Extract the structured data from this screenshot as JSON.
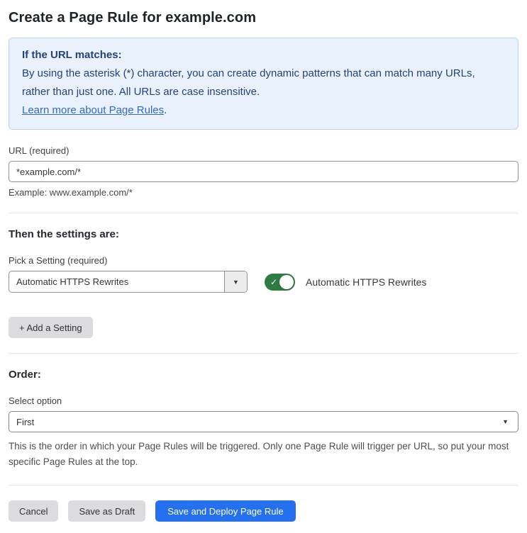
{
  "page": {
    "title": "Create a Page Rule for example.com"
  },
  "info_box": {
    "heading": "If the URL matches:",
    "body": "By using the asterisk (*) character, you can create dynamic patterns that can match many URLs, rather than just one. All URLs are case insensitive.",
    "link_label": "Learn more about Page Rules",
    "link_suffix": "."
  },
  "url_field": {
    "label": "URL (required)",
    "value": "*example.com/*",
    "hint": "Example: www.example.com/*"
  },
  "settings_section": {
    "heading": "Then the settings are:",
    "pick_label": "Pick a Setting (required)",
    "dropdown_value": "Automatic HTTPS Rewrites",
    "dropdown_arrow_icon": "▼",
    "toggle_state": "on",
    "toggle_check_icon": "✓",
    "toggle_label": "Automatic HTTPS Rewrites",
    "add_setting_label": "+ Add a Setting"
  },
  "order_section": {
    "heading": "Order:",
    "select_label": "Select option",
    "select_value": "First",
    "select_arrow_icon": "▼",
    "description": "This is the order in which your Page Rules will be triggered. Only one Page Rule will trigger per URL, so put your most specific Page Rules at the top."
  },
  "footer": {
    "cancel_label": "Cancel",
    "save_draft_label": "Save as Draft",
    "save_deploy_label": "Save and Deploy Page Rule"
  },
  "colors": {
    "info_bg": "#e9f2fc",
    "info_border": "#b8d4ef",
    "info_text": "#23437a",
    "link": "#3269c2",
    "toggle_on": "#2f7b44",
    "primary_button": "#2570ee",
    "secondary_button": "#dcdcde"
  }
}
